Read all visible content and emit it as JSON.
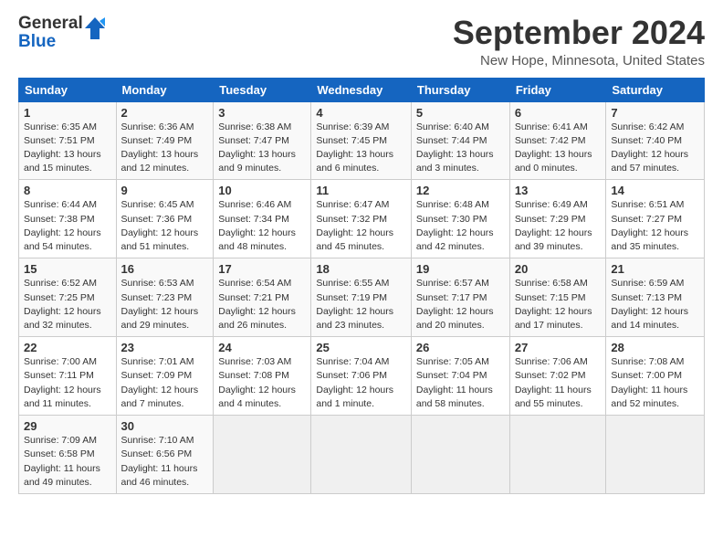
{
  "header": {
    "logo_general": "General",
    "logo_blue": "Blue",
    "month_title": "September 2024",
    "location": "New Hope, Minnesota, United States"
  },
  "columns": [
    "Sunday",
    "Monday",
    "Tuesday",
    "Wednesday",
    "Thursday",
    "Friday",
    "Saturday"
  ],
  "weeks": [
    [
      {
        "day": "1",
        "sunrise": "Sunrise: 6:35 AM",
        "sunset": "Sunset: 7:51 PM",
        "daylight": "Daylight: 13 hours and 15 minutes."
      },
      {
        "day": "2",
        "sunrise": "Sunrise: 6:36 AM",
        "sunset": "Sunset: 7:49 PM",
        "daylight": "Daylight: 13 hours and 12 minutes."
      },
      {
        "day": "3",
        "sunrise": "Sunrise: 6:38 AM",
        "sunset": "Sunset: 7:47 PM",
        "daylight": "Daylight: 13 hours and 9 minutes."
      },
      {
        "day": "4",
        "sunrise": "Sunrise: 6:39 AM",
        "sunset": "Sunset: 7:45 PM",
        "daylight": "Daylight: 13 hours and 6 minutes."
      },
      {
        "day": "5",
        "sunrise": "Sunrise: 6:40 AM",
        "sunset": "Sunset: 7:44 PM",
        "daylight": "Daylight: 13 hours and 3 minutes."
      },
      {
        "day": "6",
        "sunrise": "Sunrise: 6:41 AM",
        "sunset": "Sunset: 7:42 PM",
        "daylight": "Daylight: 13 hours and 0 minutes."
      },
      {
        "day": "7",
        "sunrise": "Sunrise: 6:42 AM",
        "sunset": "Sunset: 7:40 PM",
        "daylight": "Daylight: 12 hours and 57 minutes."
      }
    ],
    [
      {
        "day": "8",
        "sunrise": "Sunrise: 6:44 AM",
        "sunset": "Sunset: 7:38 PM",
        "daylight": "Daylight: 12 hours and 54 minutes."
      },
      {
        "day": "9",
        "sunrise": "Sunrise: 6:45 AM",
        "sunset": "Sunset: 7:36 PM",
        "daylight": "Daylight: 12 hours and 51 minutes."
      },
      {
        "day": "10",
        "sunrise": "Sunrise: 6:46 AM",
        "sunset": "Sunset: 7:34 PM",
        "daylight": "Daylight: 12 hours and 48 minutes."
      },
      {
        "day": "11",
        "sunrise": "Sunrise: 6:47 AM",
        "sunset": "Sunset: 7:32 PM",
        "daylight": "Daylight: 12 hours and 45 minutes."
      },
      {
        "day": "12",
        "sunrise": "Sunrise: 6:48 AM",
        "sunset": "Sunset: 7:30 PM",
        "daylight": "Daylight: 12 hours and 42 minutes."
      },
      {
        "day": "13",
        "sunrise": "Sunrise: 6:49 AM",
        "sunset": "Sunset: 7:29 PM",
        "daylight": "Daylight: 12 hours and 39 minutes."
      },
      {
        "day": "14",
        "sunrise": "Sunrise: 6:51 AM",
        "sunset": "Sunset: 7:27 PM",
        "daylight": "Daylight: 12 hours and 35 minutes."
      }
    ],
    [
      {
        "day": "15",
        "sunrise": "Sunrise: 6:52 AM",
        "sunset": "Sunset: 7:25 PM",
        "daylight": "Daylight: 12 hours and 32 minutes."
      },
      {
        "day": "16",
        "sunrise": "Sunrise: 6:53 AM",
        "sunset": "Sunset: 7:23 PM",
        "daylight": "Daylight: 12 hours and 29 minutes."
      },
      {
        "day": "17",
        "sunrise": "Sunrise: 6:54 AM",
        "sunset": "Sunset: 7:21 PM",
        "daylight": "Daylight: 12 hours and 26 minutes."
      },
      {
        "day": "18",
        "sunrise": "Sunrise: 6:55 AM",
        "sunset": "Sunset: 7:19 PM",
        "daylight": "Daylight: 12 hours and 23 minutes."
      },
      {
        "day": "19",
        "sunrise": "Sunrise: 6:57 AM",
        "sunset": "Sunset: 7:17 PM",
        "daylight": "Daylight: 12 hours and 20 minutes."
      },
      {
        "day": "20",
        "sunrise": "Sunrise: 6:58 AM",
        "sunset": "Sunset: 7:15 PM",
        "daylight": "Daylight: 12 hours and 17 minutes."
      },
      {
        "day": "21",
        "sunrise": "Sunrise: 6:59 AM",
        "sunset": "Sunset: 7:13 PM",
        "daylight": "Daylight: 12 hours and 14 minutes."
      }
    ],
    [
      {
        "day": "22",
        "sunrise": "Sunrise: 7:00 AM",
        "sunset": "Sunset: 7:11 PM",
        "daylight": "Daylight: 12 hours and 11 minutes."
      },
      {
        "day": "23",
        "sunrise": "Sunrise: 7:01 AM",
        "sunset": "Sunset: 7:09 PM",
        "daylight": "Daylight: 12 hours and 7 minutes."
      },
      {
        "day": "24",
        "sunrise": "Sunrise: 7:03 AM",
        "sunset": "Sunset: 7:08 PM",
        "daylight": "Daylight: 12 hours and 4 minutes."
      },
      {
        "day": "25",
        "sunrise": "Sunrise: 7:04 AM",
        "sunset": "Sunset: 7:06 PM",
        "daylight": "Daylight: 12 hours and 1 minute."
      },
      {
        "day": "26",
        "sunrise": "Sunrise: 7:05 AM",
        "sunset": "Sunset: 7:04 PM",
        "daylight": "Daylight: 11 hours and 58 minutes."
      },
      {
        "day": "27",
        "sunrise": "Sunrise: 7:06 AM",
        "sunset": "Sunset: 7:02 PM",
        "daylight": "Daylight: 11 hours and 55 minutes."
      },
      {
        "day": "28",
        "sunrise": "Sunrise: 7:08 AM",
        "sunset": "Sunset: 7:00 PM",
        "daylight": "Daylight: 11 hours and 52 minutes."
      }
    ],
    [
      {
        "day": "29",
        "sunrise": "Sunrise: 7:09 AM",
        "sunset": "Sunset: 6:58 PM",
        "daylight": "Daylight: 11 hours and 49 minutes."
      },
      {
        "day": "30",
        "sunrise": "Sunrise: 7:10 AM",
        "sunset": "Sunset: 6:56 PM",
        "daylight": "Daylight: 11 hours and 46 minutes."
      },
      {
        "day": "",
        "sunrise": "",
        "sunset": "",
        "daylight": ""
      },
      {
        "day": "",
        "sunrise": "",
        "sunset": "",
        "daylight": ""
      },
      {
        "day": "",
        "sunrise": "",
        "sunset": "",
        "daylight": ""
      },
      {
        "day": "",
        "sunrise": "",
        "sunset": "",
        "daylight": ""
      },
      {
        "day": "",
        "sunrise": "",
        "sunset": "",
        "daylight": ""
      }
    ]
  ]
}
